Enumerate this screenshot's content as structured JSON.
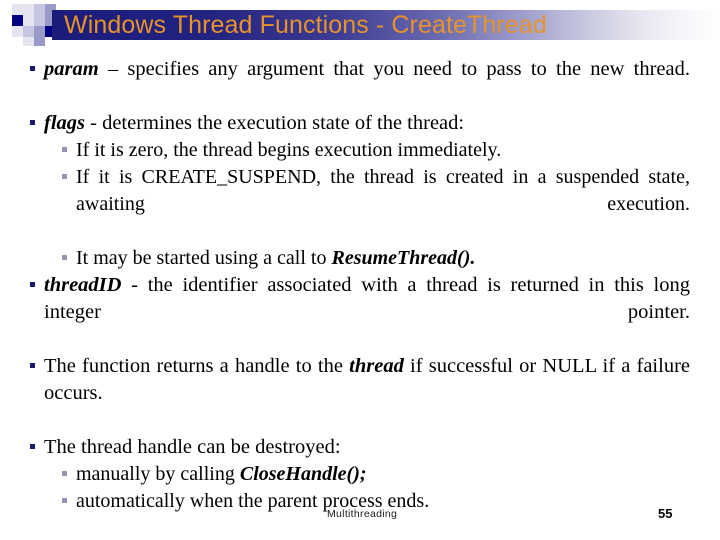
{
  "slide": {
    "title": "Windows Thread Functions - CreateThread",
    "title_color": "#e8922c",
    "title_band_color": "#1b1b7a",
    "bullet_color_level1": "#1a1a6e",
    "bullet_color_level2": "#9494b4"
  },
  "bullets": [
    {
      "level": 1,
      "lead": "param",
      "lead_style": "bold-italic",
      "text": " – specifies any argument that you need to pass to the new thread.",
      "tail": "",
      "tail_style": "",
      "after": ""
    },
    {
      "level": 1,
      "lead": "flags",
      "lead_style": "bold-italic",
      "text": " - determines the execution state of the thread:",
      "tail": "",
      "tail_style": "",
      "after": ""
    },
    {
      "level": 2,
      "lead": "",
      "lead_style": "",
      "text": "If it is zero, the thread begins execution immediately.",
      "tail": "",
      "tail_style": "",
      "after": ""
    },
    {
      "level": 2,
      "lead": "",
      "lead_style": "",
      "text": "If it is CREATE_SUSPEND, the thread is created in a suspended state, awaiting execution.",
      "tail": "",
      "tail_style": "",
      "after": ""
    },
    {
      "level": 2,
      "lead": "",
      "lead_style": "",
      "text": "It may be started using a call to ",
      "tail": "ResumeThread().",
      "tail_style": "bold-italic",
      "after": ""
    },
    {
      "level": 1,
      "lead": "threadID",
      "lead_style": "bold-italic",
      "text": "  - the identifier associated with a thread is returned in this long integer pointer.",
      "tail": "",
      "tail_style": "",
      "after": ""
    },
    {
      "level": 1,
      "lead": "",
      "lead_style": "",
      "text": "The function returns a handle to the ",
      "tail": "thread",
      "tail_style": "bold-italic",
      "after": " if successful or NULL if a failure occurs."
    },
    {
      "level": 1,
      "lead": "",
      "lead_style": "",
      "text": "The thread handle can be destroyed:",
      "tail": "",
      "tail_style": "",
      "after": ""
    },
    {
      "level": 2,
      "lead": "",
      "lead_style": "",
      "text": "manually by calling ",
      "tail": "CloseHandle();",
      "tail_style": "bold-italic",
      "after": ""
    },
    {
      "level": 2,
      "lead": "",
      "lead_style": "",
      "text": "automatically when the parent process ends.",
      "tail": "",
      "tail_style": "",
      "after": ""
    }
  ],
  "footer": {
    "label": "Multithreading",
    "page_number": "55"
  }
}
